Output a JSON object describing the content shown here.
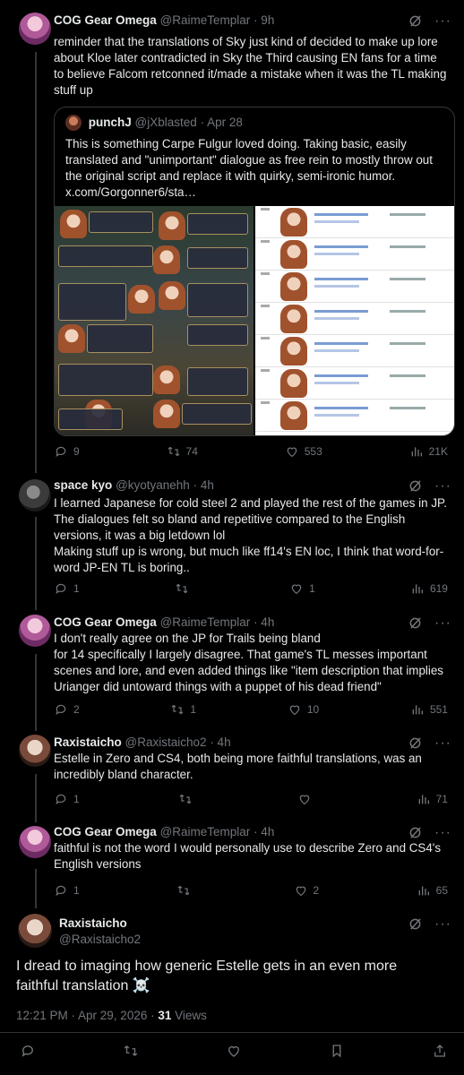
{
  "tweets": [
    {
      "name": "COG Gear Omega",
      "handle": "@RaimeTemplar",
      "time": "· 9h",
      "text": "reminder that the translations of Sky just kind of decided to make up lore about Kloe later contradicted in Sky the Third causing EN fans for a time to believe Falcom retconned it/made a mistake when it was the TL making stuff up",
      "quote": {
        "name": "punchJ",
        "handle": "@jXblasted",
        "time": "· Apr 28",
        "text": "This is something Carpe Fulgur loved doing. Taking basic, easily translated and \"unimportant\" dialogue as free rein to mostly throw out the original script and replace it with quirky, semi-ironic humor.",
        "link": "x.com/Gorgonner6/sta…"
      },
      "stats": {
        "replies": "9",
        "retweets": "74",
        "likes": "553",
        "views": "21K"
      }
    },
    {
      "name": "space kyo",
      "handle": "@kyotyanehh",
      "time": "· 4h",
      "text": "I learned Japanese for cold steel 2 and played the rest of the games in JP. The dialogues felt so bland and repetitive compared to the English versions, it was a big letdown lol\nMaking stuff up is wrong, but much like ff14's EN loc, I think that word-for-word JP-EN TL is boring..",
      "stats": {
        "replies": "1",
        "retweets": "",
        "likes": "1",
        "views": "619"
      }
    },
    {
      "name": "COG Gear Omega",
      "handle": "@RaimeTemplar",
      "time": "· 4h",
      "text": "I don't really agree on the JP for Trails being bland\n for 14 specifically I largely disagree. That game's TL messes  important scenes and lore, and even added things like \"item description that implies Urianger did untoward things with a puppet of his dead friend\"",
      "stats": {
        "replies": "2",
        "retweets": "1",
        "likes": "10",
        "views": "551"
      }
    },
    {
      "name": "Raxistaicho",
      "handle": "@Raxistaicho2",
      "time": "· 4h",
      "text": "Estelle in Zero and CS4, both being more faithful translations, was an incredibly bland character.",
      "stats": {
        "replies": "1",
        "retweets": "",
        "likes": "",
        "views": "71"
      }
    },
    {
      "name": "COG Gear Omega",
      "handle": "@RaimeTemplar",
      "time": "· 4h",
      "text": "faithful is not the word I would personally use to describe Zero and CS4's English versions",
      "stats": {
        "replies": "1",
        "retweets": "",
        "likes": "2",
        "views": "65"
      }
    }
  ],
  "main": {
    "name": "Raxistaicho",
    "handle": "@Raxistaicho2",
    "text": "I dread to imaging how generic Estelle gets in an even more faithful translation ☠️",
    "timestamp": "12:21 PM · Apr 29, 2026 · ",
    "views_count": "31",
    "views_label": " Views"
  },
  "colors": {
    "background": "#000000",
    "text": "#e7e9ea",
    "muted": "#71767b",
    "border": "#2f3336"
  }
}
